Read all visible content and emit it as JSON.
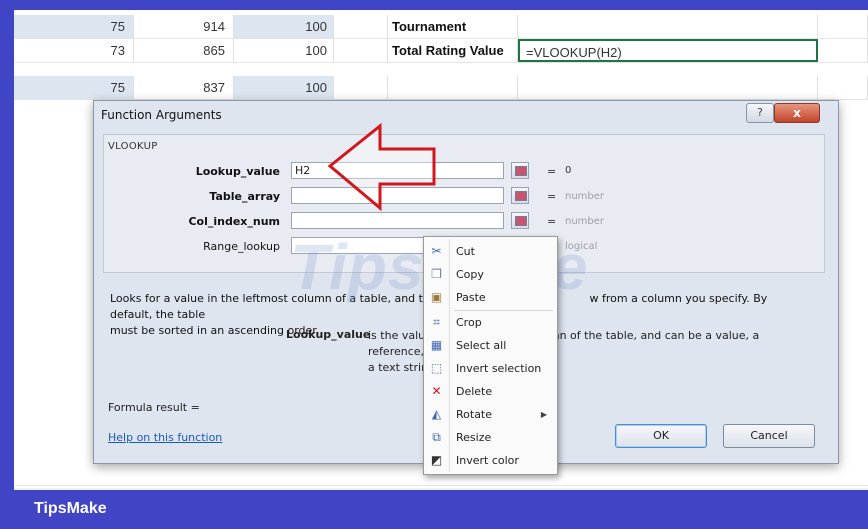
{
  "sheet": {
    "rows": [
      {
        "a": "75",
        "b": "914",
        "c": "100",
        "label": "Tournament",
        "value": ""
      },
      {
        "a": "73",
        "b": "865",
        "c": "100",
        "label": "Total Rating Value",
        "value": "=VLOOKUP(H2)"
      },
      {
        "a": "75",
        "b": "837",
        "c": "100",
        "label": "",
        "value": ""
      }
    ]
  },
  "dialog": {
    "title": "Function Arguments",
    "help_btn": "?",
    "close_btn": "x",
    "function_name": "VLOOKUP",
    "args": [
      {
        "label": "Lookup_value",
        "value": "H2",
        "eq": "=",
        "result": "0"
      },
      {
        "label": "Table_array",
        "value": "",
        "eq": "=",
        "result": "number"
      },
      {
        "label": "Col_index_num",
        "value": "",
        "eq": "=",
        "result": "number"
      },
      {
        "label": "Range_lookup",
        "value": "",
        "eq": "=",
        "result": "logical"
      }
    ],
    "description": "Looks for a value in the leftmost column of a table, and then ret",
    "description_end": "w from a column you specify. By default, the table",
    "description_line2": "must be sorted in an ascending order.",
    "arg_help_name": "Lookup_value",
    "arg_help_text": "is the value",
    "arg_help_text_end": "umn of the table, and can be a value, a reference, or",
    "arg_help_text2": "a text string",
    "formula_result_label": "Formula result =",
    "help_link": "Help on this function",
    "ok": "OK",
    "cancel": "Cancel"
  },
  "context_menu": {
    "items": [
      {
        "label": "Cut",
        "icon": "scissors-icon"
      },
      {
        "label": "Copy",
        "icon": "copy-icon"
      },
      {
        "label": "Paste",
        "icon": "paste-icon"
      },
      {
        "label": "Crop",
        "icon": "crop-icon"
      },
      {
        "label": "Select all",
        "icon": "select-all-icon"
      },
      {
        "label": "Invert selection",
        "icon": "invert-selection-icon"
      },
      {
        "label": "Delete",
        "icon": "delete-icon"
      },
      {
        "label": "Rotate",
        "icon": "rotate-icon"
      },
      {
        "label": "Resize",
        "icon": "resize-icon"
      },
      {
        "label": "Invert color",
        "icon": "invert-color-icon"
      }
    ]
  },
  "watermark": "TipsMake",
  "brand": "TipsMake",
  "colors": {
    "brand_bar": "#3f45c5",
    "arrow": "#d0161e",
    "accent_link": "#1a5ab5",
    "shade": "#dce6f1"
  }
}
